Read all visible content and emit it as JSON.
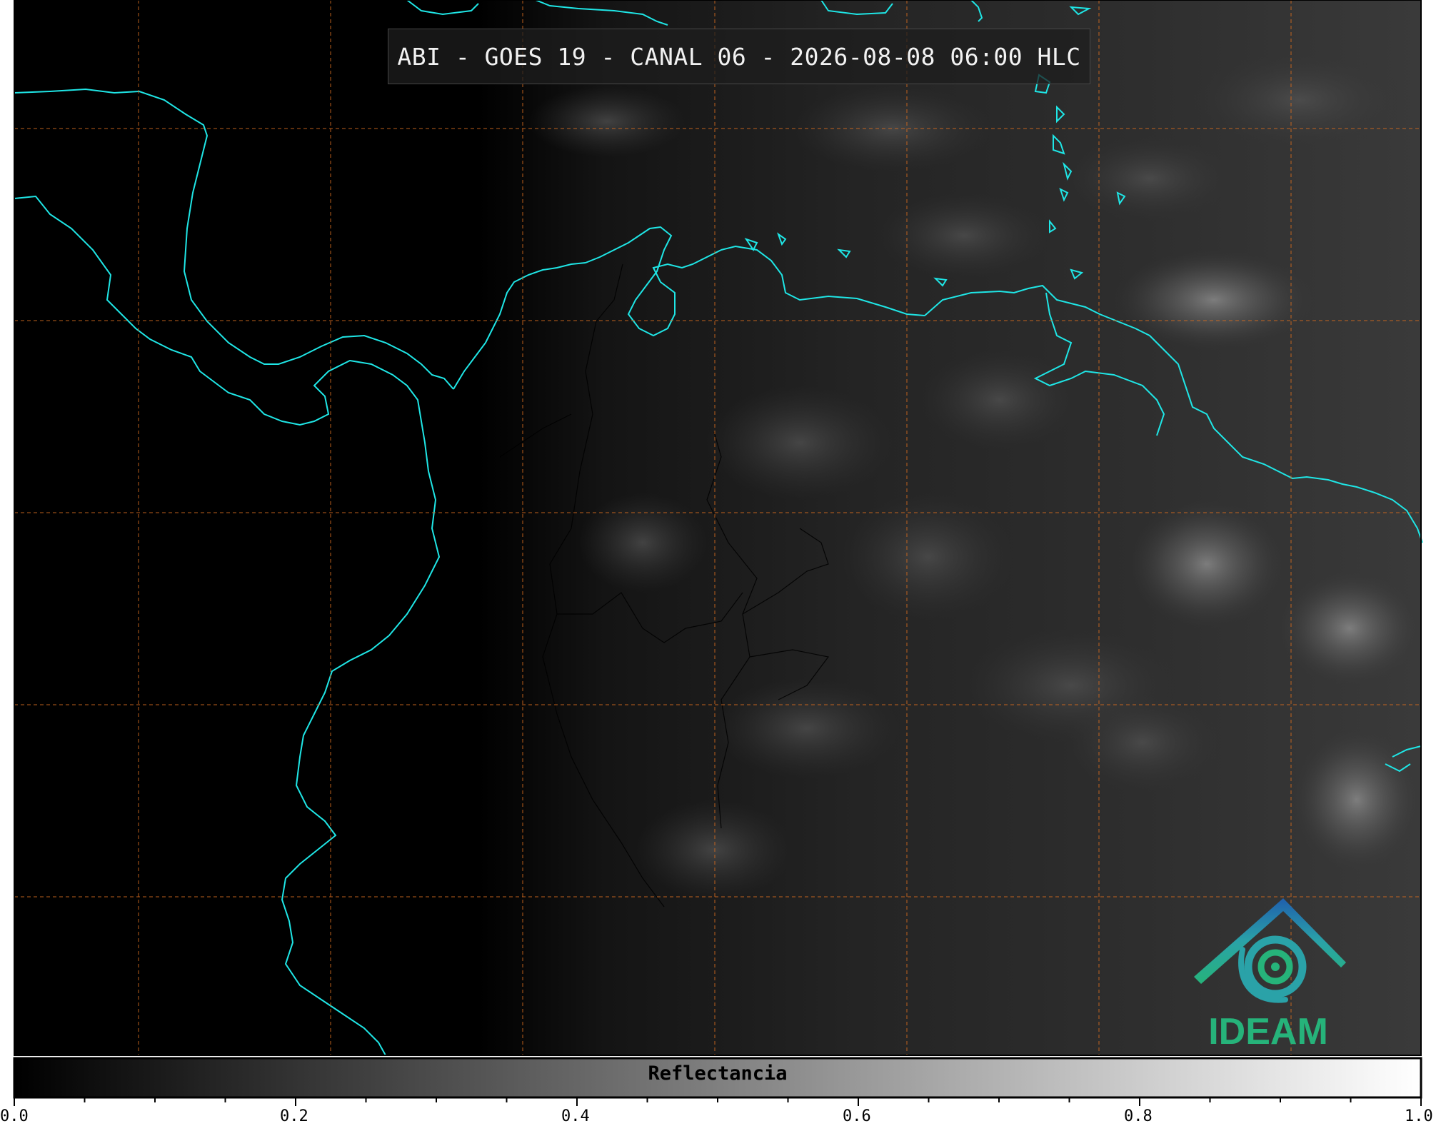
{
  "title": "ABI - GOES 19 - CANAL 06 - 2026-08-08 06:00 HLC",
  "colorbar": {
    "label": "Reflectancia",
    "range": [
      0.0,
      1.0
    ],
    "ticks": [
      "0.0",
      "0.2",
      "0.4",
      "0.6",
      "0.8",
      "1.0"
    ],
    "minor_tick_step": 0.05,
    "colormap": [
      "#000000",
      "#ffffff"
    ]
  },
  "map_style": {
    "coastline_color": "#1fe6e6",
    "border_color": "#000000",
    "gridline_color": "#d2691e",
    "gridline_style": "dashed"
  },
  "logo": {
    "text": "IDEAM",
    "colors": [
      "#1f5fae",
      "#2aa2a8",
      "#26b37a"
    ]
  }
}
